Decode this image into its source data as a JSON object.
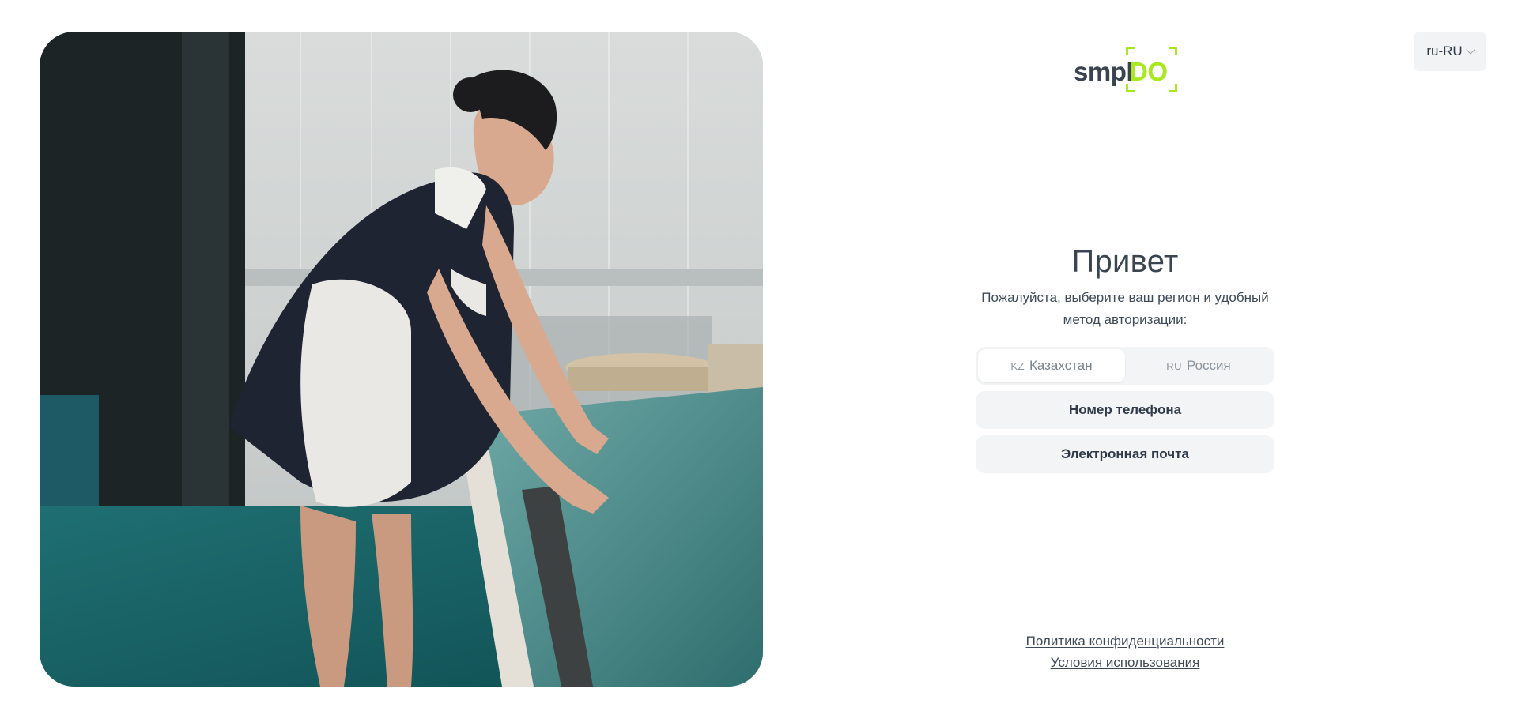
{
  "language": {
    "selected": "ru-RU"
  },
  "logo": {
    "part1": "smpl",
    "part2": "DO",
    "accent_color": "#a7e81e"
  },
  "auth": {
    "title": "Привет",
    "subtitle": "Пожалуйста, выберите ваш регион и удобный метод авторизации:",
    "regions": [
      {
        "code": "KZ",
        "label": "Казахстан",
        "active": true
      },
      {
        "code": "RU",
        "label": "Россия",
        "active": false
      }
    ],
    "methods": [
      {
        "label": "Номер телефона"
      },
      {
        "label": "Электронная почта"
      }
    ]
  },
  "footer": {
    "privacy_label": "Политика конфиденциальности",
    "terms_label": "Условия использования"
  }
}
